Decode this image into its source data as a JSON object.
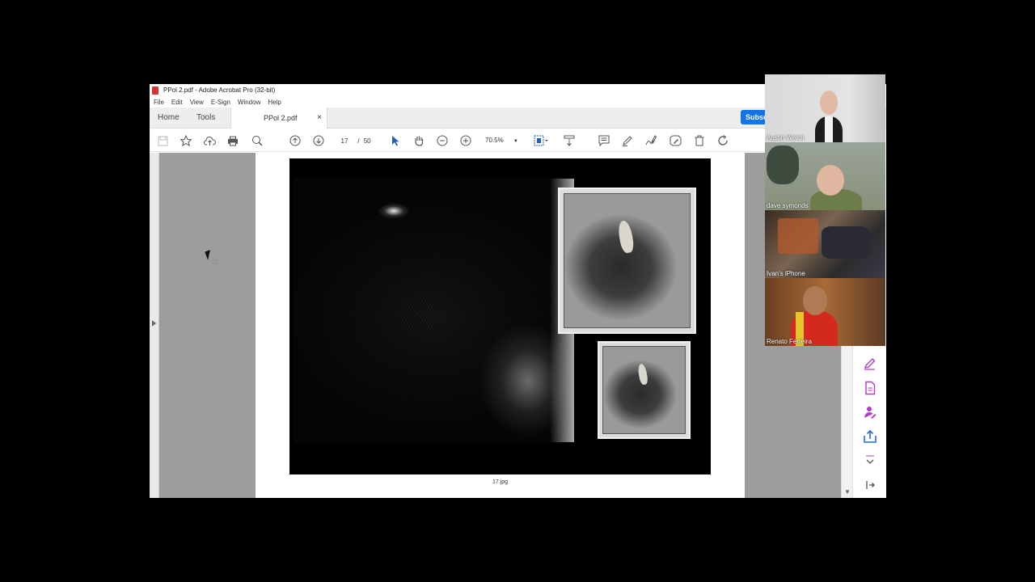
{
  "window": {
    "title": "PPol 2.pdf - Adobe Acrobat Pro (32-bit)"
  },
  "menu": [
    "File",
    "Edit",
    "View",
    "E-Sign",
    "Window",
    "Help"
  ],
  "tabs": {
    "home": "Home",
    "tools": "Tools",
    "document": "PPol 2.pdf",
    "close": "×"
  },
  "subscribe": {
    "label": "Subsc"
  },
  "toolbar": {
    "page_current": "17",
    "page_separator": "/",
    "page_total": "50",
    "zoom": "70.5%"
  },
  "document": {
    "caption": "17.jpg"
  },
  "participants": [
    {
      "name": "Austin Welch"
    },
    {
      "name": "dave symonds"
    },
    {
      "name": "Ivan's iPhone"
    },
    {
      "name": "Renato Ferreira"
    }
  ],
  "colors": {
    "accent": "#1473e6",
    "select_tool": "#1f5fbf",
    "rail_icon": "#b23ac8"
  }
}
